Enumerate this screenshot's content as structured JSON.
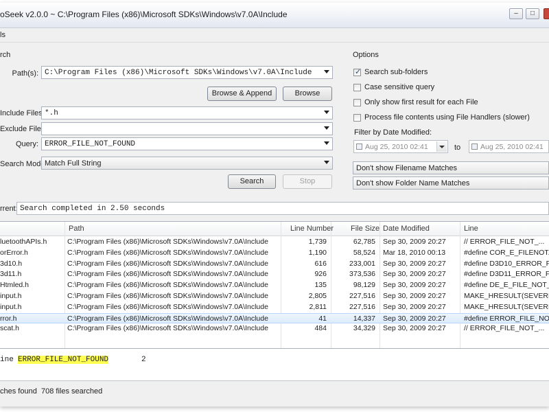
{
  "window": {
    "title": "oSeek v2.0.0 ~ C:\\Program Files (x86)\\Microsoft SDKs\\Windows\\v7.0A\\Include"
  },
  "menu": {
    "partial_item": "ls"
  },
  "search": {
    "group_label": "rch",
    "paths_label": "Path(s):",
    "paths_value": "C:\\Program Files (x86)\\Microsoft SDKs\\Windows\\v7.0A\\Include",
    "browse_append_label": "Browse & Append",
    "browse_label": "Browse",
    "include_label": "Include Files:",
    "include_value": "*.h",
    "exclude_label": "Exclude Files:",
    "exclude_value": "",
    "query_label": "Query:",
    "query_value": "ERROR_FILE_NOT_FOUND",
    "mode_label": "Search Mode:",
    "mode_value": "Match Full String",
    "search_button": "Search",
    "stop_button": "Stop"
  },
  "options": {
    "group_label": "Options",
    "subfolders": {
      "label": "Search sub-folders",
      "checked": true
    },
    "case_sensitive": {
      "label": "Case sensitive query",
      "checked": false
    },
    "first_result": {
      "label": "Only show first result for each File",
      "checked": false
    },
    "file_handlers": {
      "label": "Process file contents using File Handlers (slower)",
      "checked": false
    },
    "date_filter_label": "Filter by Date Modified:",
    "date_from": "Aug 25, 2010 02:41",
    "date_to_label": "to",
    "date_to": "Aug 25, 2010 02:41",
    "filename_matches": "Don't show Filename Matches",
    "folder_matches": "Don't show Folder Name Matches"
  },
  "status": {
    "label": "rrent:",
    "value": "Search completed in 2.50 seconds"
  },
  "results": {
    "columns": [
      "",
      "Path",
      "Line Number",
      "File Size",
      "Date Modified",
      "Line"
    ],
    "rows": [
      {
        "file": "luetoothAPIs.h",
        "path": "C:\\Program Files (x86)\\Microsoft SDKs\\Windows\\v7.0A\\Include",
        "line_number": "1,739",
        "size": "62,785",
        "modified": "Sep 30, 2009 20:27",
        "line": "//     ERROR_FILE_NOT_..."
      },
      {
        "file": "orError.h",
        "path": "C:\\Program Files (x86)\\Microsoft SDKs\\Windows\\v7.0A\\Include",
        "line_number": "1,190",
        "size": "58,524",
        "modified": "Mar 18, 2010 00:13",
        "line": "#define COR_E_FILENOT..."
      },
      {
        "file": "3d10.h",
        "path": "C:\\Program Files (x86)\\Microsoft SDKs\\Windows\\v7.0A\\Include",
        "line_number": "616",
        "size": "233,001",
        "modified": "Sep 30, 2009 20:27",
        "line": "#define D3D10_ERROR_F..."
      },
      {
        "file": "3d11.h",
        "path": "C:\\Program Files (x86)\\Microsoft SDKs\\Windows\\v7.0A\\Include",
        "line_number": "926",
        "size": "373,536",
        "modified": "Sep 30, 2009 20:27",
        "line": "#define D3D11_ERROR_F..."
      },
      {
        "file": "Htmled.h",
        "path": "C:\\Program Files (x86)\\Microsoft SDKs\\Windows\\v7.0A\\Include",
        "line_number": "135",
        "size": "98,129",
        "modified": "Sep 30, 2009 20:27",
        "line": "#define DE_E_FILE_NOT_..."
      },
      {
        "file": "input.h",
        "path": "C:\\Program Files (x86)\\Microsoft SDKs\\Windows\\v7.0A\\Include",
        "line_number": "2,805",
        "size": "227,516",
        "modified": "Sep 30, 2009 20:27",
        "line": "MAKE_HRESULT(SEVERI..."
      },
      {
        "file": "input.h",
        "path": "C:\\Program Files (x86)\\Microsoft SDKs\\Windows\\v7.0A\\Include",
        "line_number": "2,811",
        "size": "227,516",
        "modified": "Sep 30, 2009 20:27",
        "line": "MAKE_HRESULT(SEVERI..."
      },
      {
        "file": "rror.h",
        "path": "C:\\Program Files (x86)\\Microsoft SDKs\\Windows\\v7.0A\\Include",
        "line_number": "41",
        "size": "14,337",
        "modified": "Sep 30, 2009 20:27",
        "line": "#define ERROR_FILE_NO..."
      },
      {
        "file": "scat.h",
        "path": "C:\\Program Files (x86)\\Microsoft SDKs\\Windows\\v7.0A\\Include",
        "line_number": "484",
        "size": "34,329",
        "modified": "Sep 30, 2009 20:27",
        "line": "//     ERROR_FILE_NOT_..."
      }
    ]
  },
  "preview": {
    "prefix": "ine ",
    "match": "ERROR_FILE_NOT_FOUND",
    "number": "2"
  },
  "statusbar": {
    "matches": "ches found",
    "files": "708 files searched"
  }
}
